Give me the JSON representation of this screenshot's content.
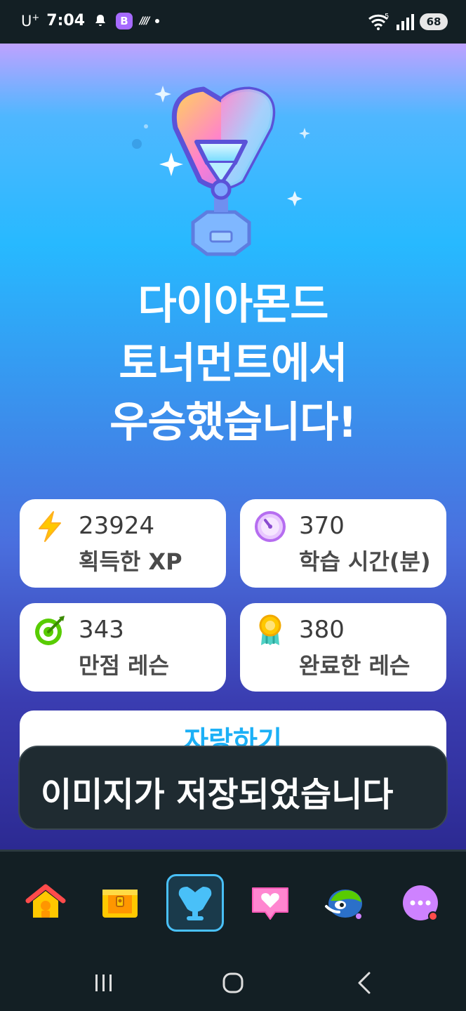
{
  "status_bar": {
    "carrier": "U",
    "carrier_sup": "+",
    "time": "7:04",
    "badge_letter": "B",
    "signal_slash": "////",
    "wifi_sub": "5",
    "battery": "68"
  },
  "hero": {
    "icon": "diamond-trophy-icon",
    "headline_line1": "다이아몬드",
    "headline_line2": "토너먼트에서",
    "headline_line3": "우승했습니다!"
  },
  "stats": [
    {
      "icon": "lightning-icon",
      "value": "23924",
      "label": "획득한 XP"
    },
    {
      "icon": "clock-icon",
      "value": "370",
      "label": "학습 시간(분)"
    },
    {
      "icon": "target-icon",
      "value": "343",
      "label": "만점 레슨"
    },
    {
      "icon": "medal-icon",
      "value": "380",
      "label": "완료한 레슨"
    }
  ],
  "share_button": {
    "label": "자랑하기"
  },
  "toast": {
    "message": "이미지가 저장되었습니다"
  },
  "bottom_nav": [
    {
      "name": "home-icon",
      "active": false
    },
    {
      "name": "treasure-chest-icon",
      "active": false
    },
    {
      "name": "leaderboard-trophy-icon",
      "active": true
    },
    {
      "name": "heart-message-icon",
      "active": false
    },
    {
      "name": "character-icon",
      "active": false
    },
    {
      "name": "more-icon",
      "active": false
    }
  ],
  "colors": {
    "accent_blue": "#1cb0f6",
    "nav_bg": "#131f24",
    "active_border": "#49c0f8"
  }
}
